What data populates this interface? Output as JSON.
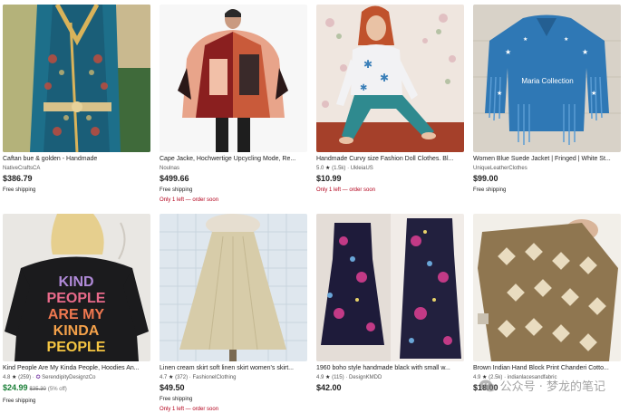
{
  "listings": [
    {
      "title": "Caftan bue & golden - Handmade",
      "seller": "NativeCraftsCA",
      "price": "$386.79",
      "shipping": "Free shipping",
      "image_icon": "green-blue-caftan-dress"
    },
    {
      "title": "Cape Jacke, Hochwertige Upcycling Mode, Re...",
      "seller": "Noulnas",
      "price": "$499.66",
      "shipping": "Free shipping",
      "stock": "Only 1 left — order soon",
      "image_icon": "patchwork-cape-jacket"
    },
    {
      "title": "Handmade Curvy size Fashion Doll Clothes. Bl...",
      "rating_value": "5.0",
      "rating_count": "(1.5k)",
      "seller": "UkleiaUS",
      "price": "$10.99",
      "stock": "Only 1 left — order soon",
      "image_icon": "doll-snowflake-sweater"
    },
    {
      "title": "Women Blue Suede Jacket | Fringed | White St...",
      "seller": "UniqueLeatherClothes",
      "price": "$99.00",
      "shipping": "Free shipping",
      "image_icon": "blue-fringed-suede-jacket"
    },
    {
      "title": "Kind People Are My Kinda People, Hoodies An...",
      "rating_value": "4.8",
      "rating_count": "(259)",
      "seller": "SerendipityDesignzCo",
      "price": "$24.99",
      "original_price": "$35.30",
      "discount": "(5% off)",
      "shipping": "Free shipping",
      "image_icon": "black-hoodie-kind-people",
      "hoodie_text": [
        "KIND",
        "PEOPLE",
        "ARE MY",
        "KINDA",
        "PEOPLE"
      ]
    },
    {
      "title": "Linen cream skirt soft linen skirt women's skirt...",
      "rating_value": "4.7",
      "rating_count": "(372)",
      "seller": "FashionelClothing",
      "price": "$49.50",
      "shipping": "Free shipping",
      "stock": "Only 1 left — order soon",
      "image_icon": "cream-linen-skirt"
    },
    {
      "title": "1960 boho style handmade black with small w...",
      "rating_value": "4.9",
      "rating_count": "(115)",
      "seller": "DesignKMDD",
      "price": "$42.00",
      "image_icon": "floral-boho-dress"
    },
    {
      "title": "Brown Indian Hand Block Print Chanderi Cotto...",
      "rating_value": "4.9",
      "rating_count": "(2.5k)",
      "seller": "indianlacesandfabric",
      "price": "$18.00",
      "image_icon": "block-print-scarf"
    }
  ],
  "watermark": {
    "text": "公众号 · 梦龙的笔记",
    "icon": "wechat-icon"
  },
  "colors": {
    "stock_red": "#b3001b",
    "sale_green": "#1a7f37",
    "star_purple": "#7b3fa8"
  }
}
